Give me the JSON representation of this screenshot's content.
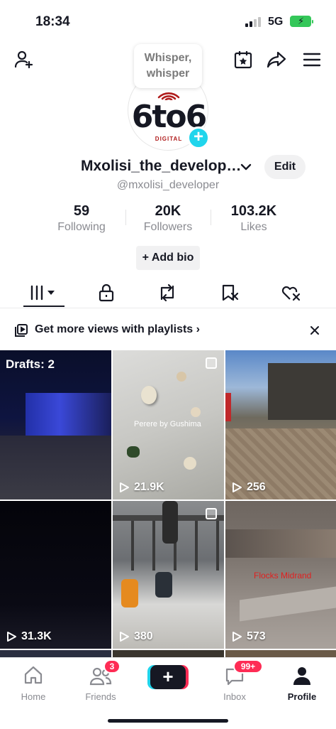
{
  "status_bar": {
    "time": "18:34",
    "network": "5G"
  },
  "whisper": {
    "line1": "Whisper,",
    "line2": "whisper"
  },
  "avatar": {
    "logo_text": "6to6",
    "logo_sub": "DIGITAL"
  },
  "profile": {
    "username": "Mxolisi_the_develop…",
    "handle": "@mxolisi_developer",
    "edit_label": "Edit",
    "add_bio_label": "+ Add bio",
    "stats": [
      {
        "value": "59",
        "label": "Following"
      },
      {
        "value": "20K",
        "label": "Followers"
      },
      {
        "value": "103.2K",
        "label": "Likes"
      }
    ]
  },
  "tabs": [
    "videos-grid-icon",
    "lock-icon",
    "repost-icon",
    "favorites-icon",
    "liked-icon"
  ],
  "playlist_banner": {
    "text": "Get more views with playlists ›"
  },
  "grid": {
    "drafts_label": "Drafts: 2",
    "videos": [
      {
        "views": "",
        "caption": ""
      },
      {
        "views": "21.9K",
        "caption": "Perere by Gushima"
      },
      {
        "views": "256",
        "caption": ""
      },
      {
        "views": "31.3K",
        "caption": ""
      },
      {
        "views": "380",
        "caption": ""
      },
      {
        "views": "573",
        "caption": "Flocks Midrand"
      }
    ]
  },
  "bottom_nav": {
    "home": "Home",
    "friends": "Friends",
    "friends_badge": "3",
    "inbox": "Inbox",
    "inbox_badge": "99+",
    "profile": "Profile"
  },
  "colors": {
    "accent_cyan": "#20d5ec",
    "accent_red": "#fe2c55",
    "text": "#161823",
    "muted": "#8a8b91"
  }
}
